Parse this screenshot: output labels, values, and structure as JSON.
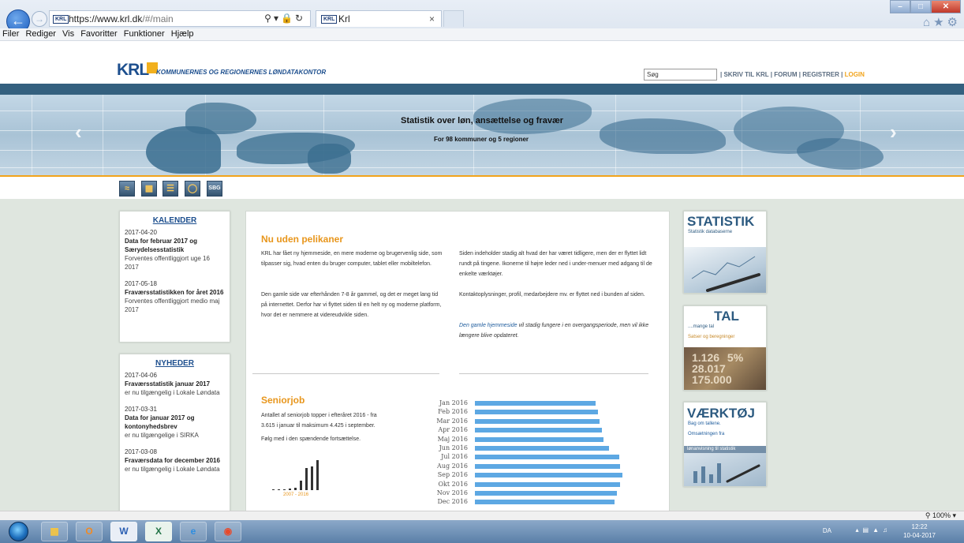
{
  "browser": {
    "address_host": "https://www.krl.dk",
    "address_path": "/#/main",
    "favicon_label": "KRL",
    "tab_title": "Krl",
    "tab_close": "×",
    "menu": [
      "Filer",
      "Rediger",
      "Vis",
      "Favoritter",
      "Funktioner",
      "Hjælp"
    ]
  },
  "site": {
    "logo_text": "KRL",
    "logo_subtitle": "KOMMUNERNES OG REGIONERNES LØNDATAKONTOR",
    "search_placeholder": "Søg",
    "top_links": {
      "write": "SKRIV TIL KRL",
      "forum": "FORUM",
      "register": "REGISTRER",
      "login": "LOGIN"
    },
    "banner_title": "Statistik over løn, ansættelse og fravær",
    "banner_subtitle": "For 98 kommuner og 5 regioner",
    "quick_icon_sbg": "SBG"
  },
  "kalender": {
    "heading": "KALENDER",
    "entries": [
      {
        "date": "2017-04-20",
        "title": "Data for februar 2017 og Særydelsesstatistik",
        "desc": "Forventes offentliggjort uge 16 2017"
      },
      {
        "date": "2017-05-18",
        "title": "Fraværsstatistikken for året 2016",
        "desc": "Forventes offentliggjort medio maj 2017"
      }
    ]
  },
  "nyheder": {
    "heading": "NYHEDER",
    "entries": [
      {
        "date": "2017-04-06",
        "title": "Fraværsstatistik januar 2017",
        "desc": "er nu tilgængelig i Lokale Løndata"
      },
      {
        "date": "2017-03-31",
        "title": "Data for januar 2017 og kontonyhedsbrev",
        "desc": "er nu tilgængelige i SIRKA"
      },
      {
        "date": "2017-03-08",
        "title": "Fraværsdata for december 2016",
        "desc": "er nu tilgængelig i Lokale Løndata"
      }
    ]
  },
  "article1": {
    "heading": "Nu uden pelikaner",
    "left_p1": "KRL har fået ny hjemmeside, en mere moderne og brugervenlig side, som tilpasser sig, hvad enten du bruger computer, tablet eller mobiltelefon.",
    "left_p2": "Den gamle side var efterhånden 7-8 år gammel, og det er meget lang tid på internettet. Derfor har vi flyttet siden til en helt ny og moderne platform, hvor det er nemmere at videreudvikle siden.",
    "right_p1": "Siden indeholder stadig alt hvad der har været tidligere, men der er flyttet lidt rundt på tingene. Ikonerne til højre leder ned i under-menuer med adgang til de enkelte værktøjer.",
    "right_p2": "Kontaktoplysninger, profil, medarbejdere mv. er flyttet ned i bunden af siden.",
    "right_p3_link": "Den gamle hjemmeside",
    "right_p3_rest": " vil stadig fungere i en overgangsperiode, men vil ikke længere blive opdateret."
  },
  "article2": {
    "heading": "Seniorjob",
    "p1": "Antallet af seniorjob topper i efteråret 2016 - fra 3.615 i januar til maksimum 4.425 i september.",
    "p2": "Følg med i den spændende fortsættelse.",
    "mini_chart_label": "2007 - 2016"
  },
  "chart_data": {
    "type": "bar",
    "orientation": "horizontal",
    "categories": [
      "Jan 2016",
      "Feb 2016",
      "Mar 2016",
      "Apr 2016",
      "Maj 2016",
      "Jun 2016",
      "Jul 2016",
      "Aug 2016",
      "Sep 2016",
      "Okt 2016",
      "Nov 2016",
      "Dec 2016"
    ],
    "values": [
      3615,
      3695,
      3745,
      3810,
      3870,
      4025,
      4330,
      4360,
      4425,
      4360,
      4255,
      4200
    ],
    "color": "#5da8e3"
  },
  "right_panels": {
    "statistik": {
      "title": "STATISTIK",
      "sub": "Statistik databaserne"
    },
    "tal": {
      "title": "TAL",
      "sub1": "....mange tal",
      "sub2": "Satser og beregninger",
      "img_text": "1.126 5% 28.017 175.000"
    },
    "vaerktoj": {
      "title": "VÆRKTØJ",
      "sub1": "Bag om tallene.",
      "sub2": "Omsætningen fra",
      "sub3": "lønanvisning til statistik"
    }
  },
  "status": {
    "zoom": "100%"
  },
  "taskbar": {
    "lang": "DA",
    "time": "12:22",
    "date": "10-04-2017"
  }
}
